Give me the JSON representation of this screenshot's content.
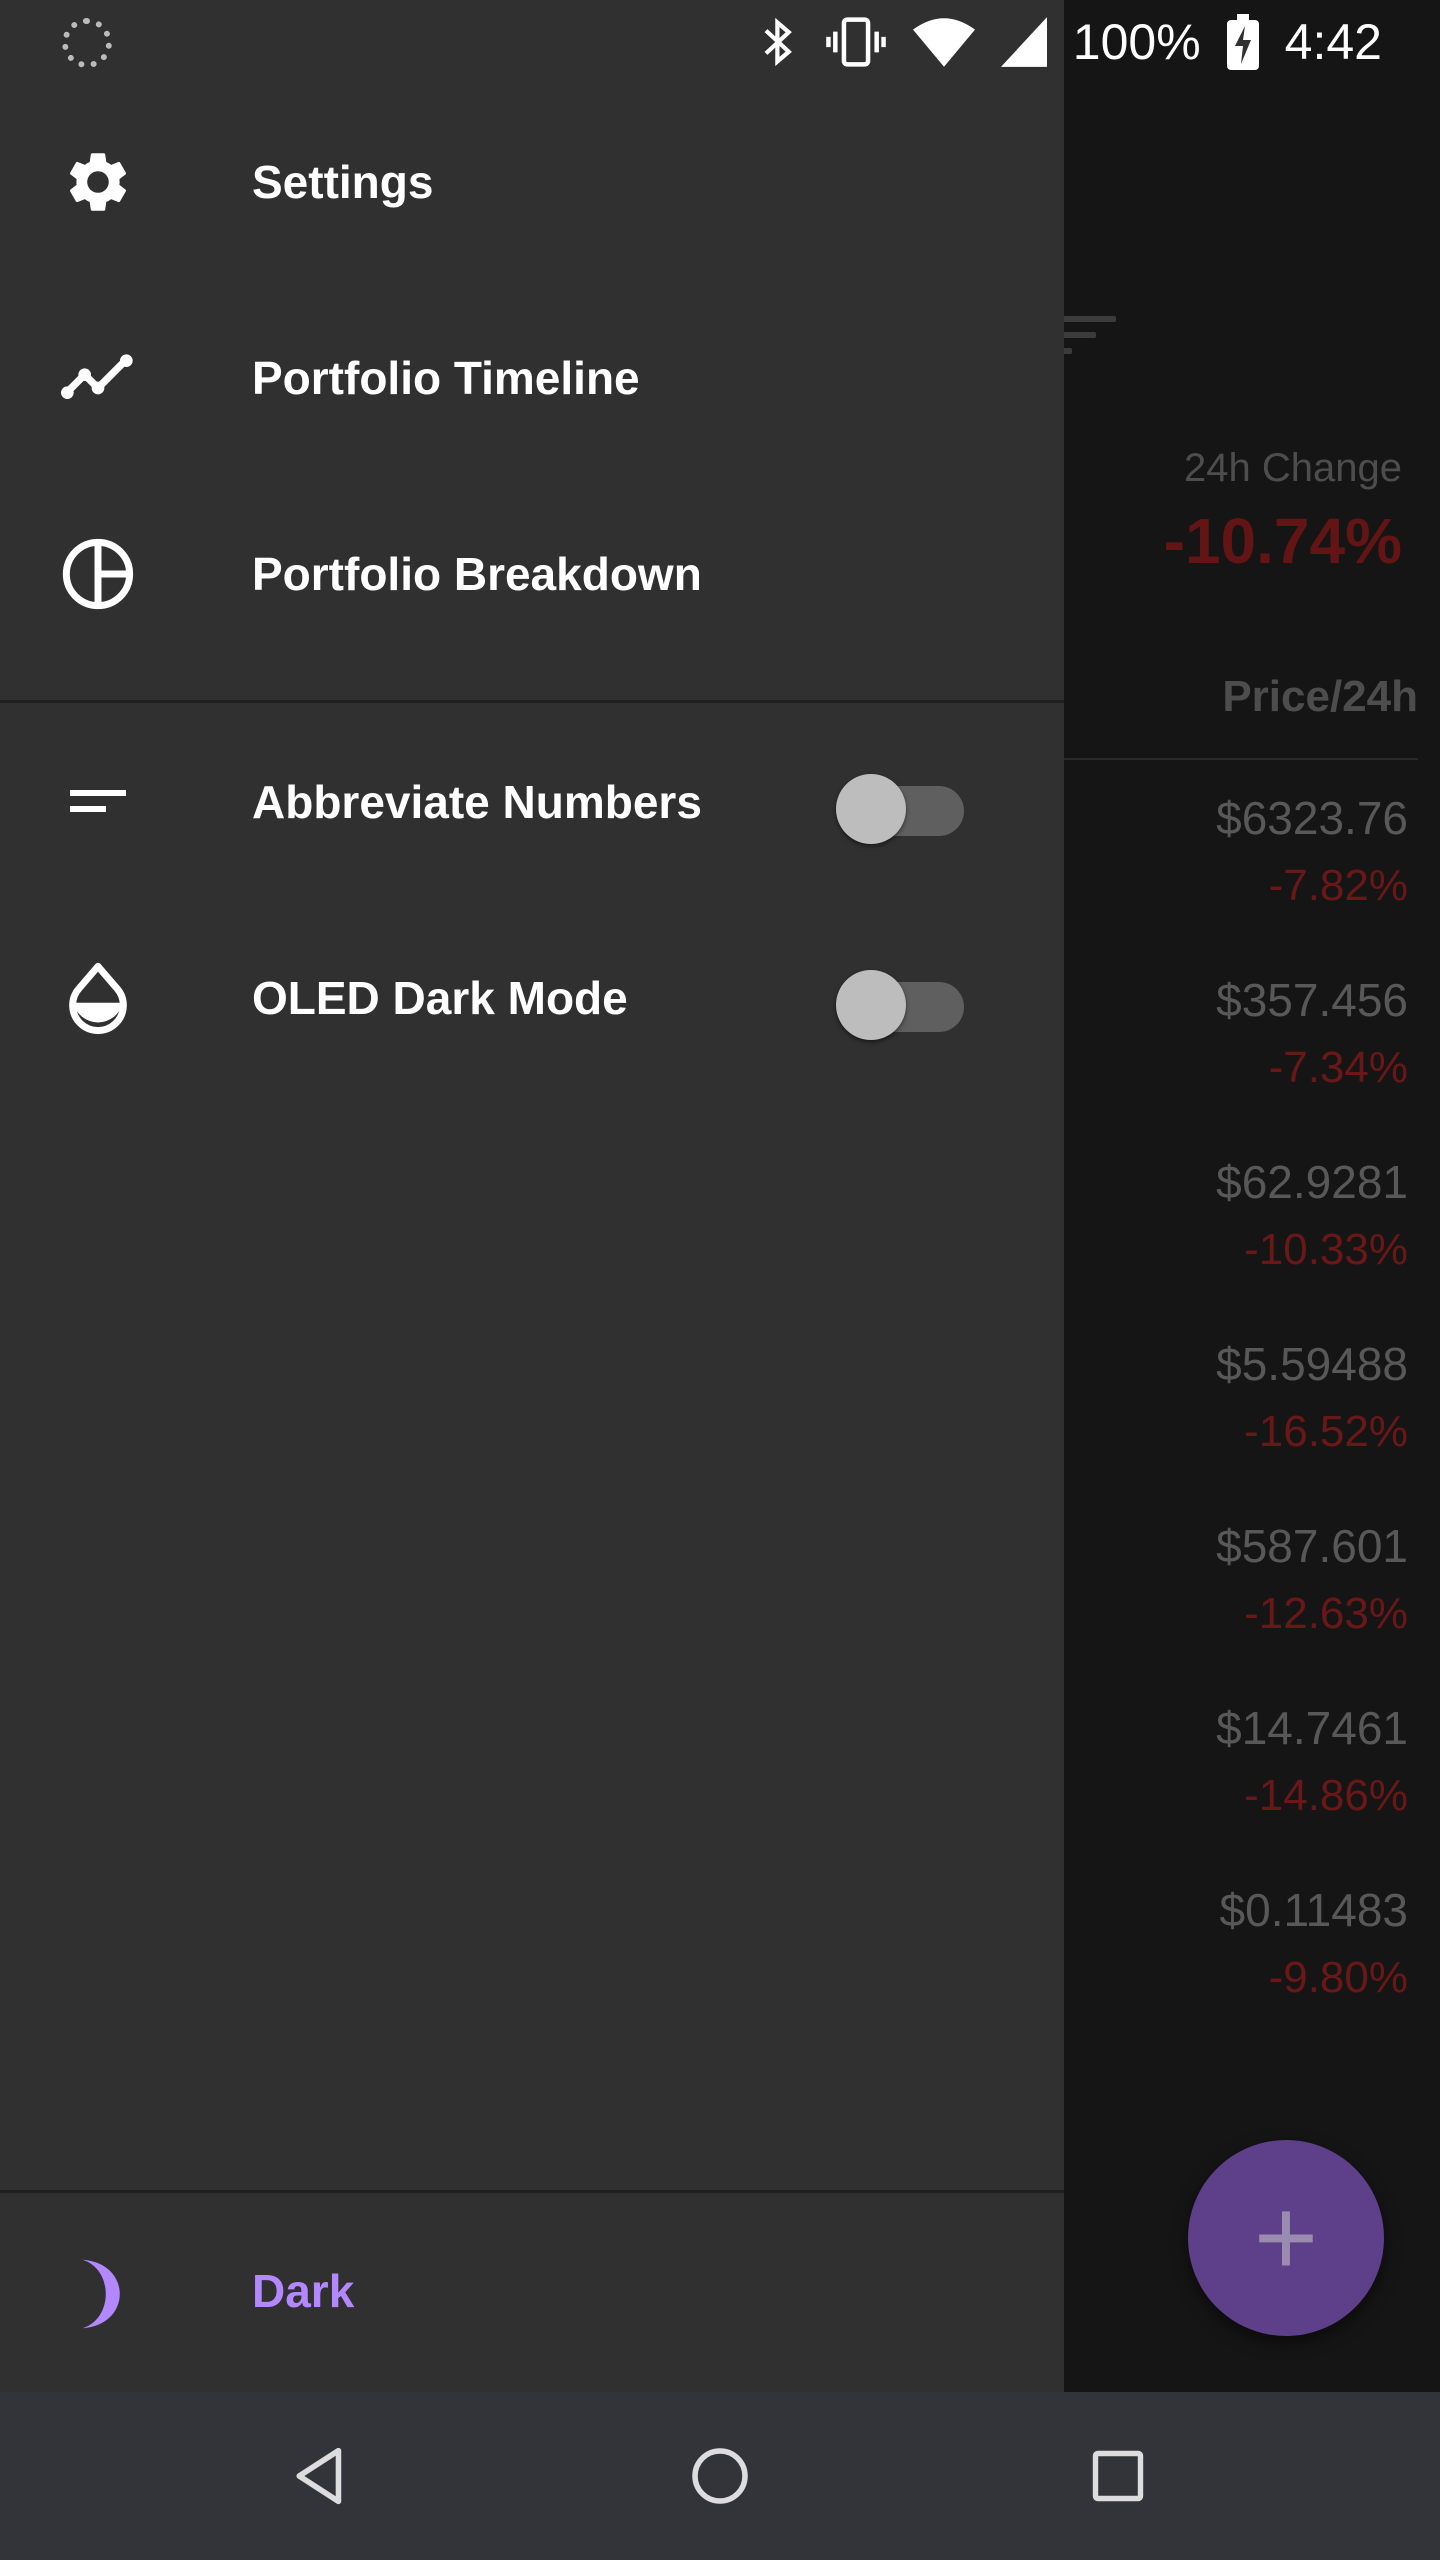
{
  "status_bar": {
    "battery": "100%",
    "time": "4:42"
  },
  "drawer": {
    "items": [
      {
        "label": "Settings",
        "icon": "gear-icon"
      },
      {
        "label": "Portfolio Timeline",
        "icon": "timeline-icon"
      },
      {
        "label": "Portfolio Breakdown",
        "icon": "pie-chart-icon"
      }
    ],
    "toggles": [
      {
        "label": "Abbreviate Numbers",
        "icon": "short-text-icon",
        "on": false
      },
      {
        "label": "OLED Dark Mode",
        "icon": "water-drop-icon",
        "on": false
      }
    ],
    "footer": {
      "label": "Dark",
      "icon": "moon-icon",
      "accent": "#b388ff"
    }
  },
  "background": {
    "change_label": "24h Change",
    "change_value": "-10.74%",
    "column_header": "Price/24h",
    "rows": [
      {
        "price": "$6323.76",
        "change": "-7.82%"
      },
      {
        "price": "$357.456",
        "change": "-7.34%"
      },
      {
        "price": "$62.9281",
        "change": "-10.33%"
      },
      {
        "price": "$5.59488",
        "change": "-16.52%"
      },
      {
        "price": "$587.601",
        "change": "-12.63%"
      },
      {
        "price": "$14.7461",
        "change": "-14.86%"
      },
      {
        "price": "$0.11483",
        "change": "-9.80%"
      }
    ],
    "fab_label": "+"
  },
  "colors": {
    "drawer_bg": "#303030",
    "accent": "#b388ff",
    "negative": "#d32f2f"
  }
}
